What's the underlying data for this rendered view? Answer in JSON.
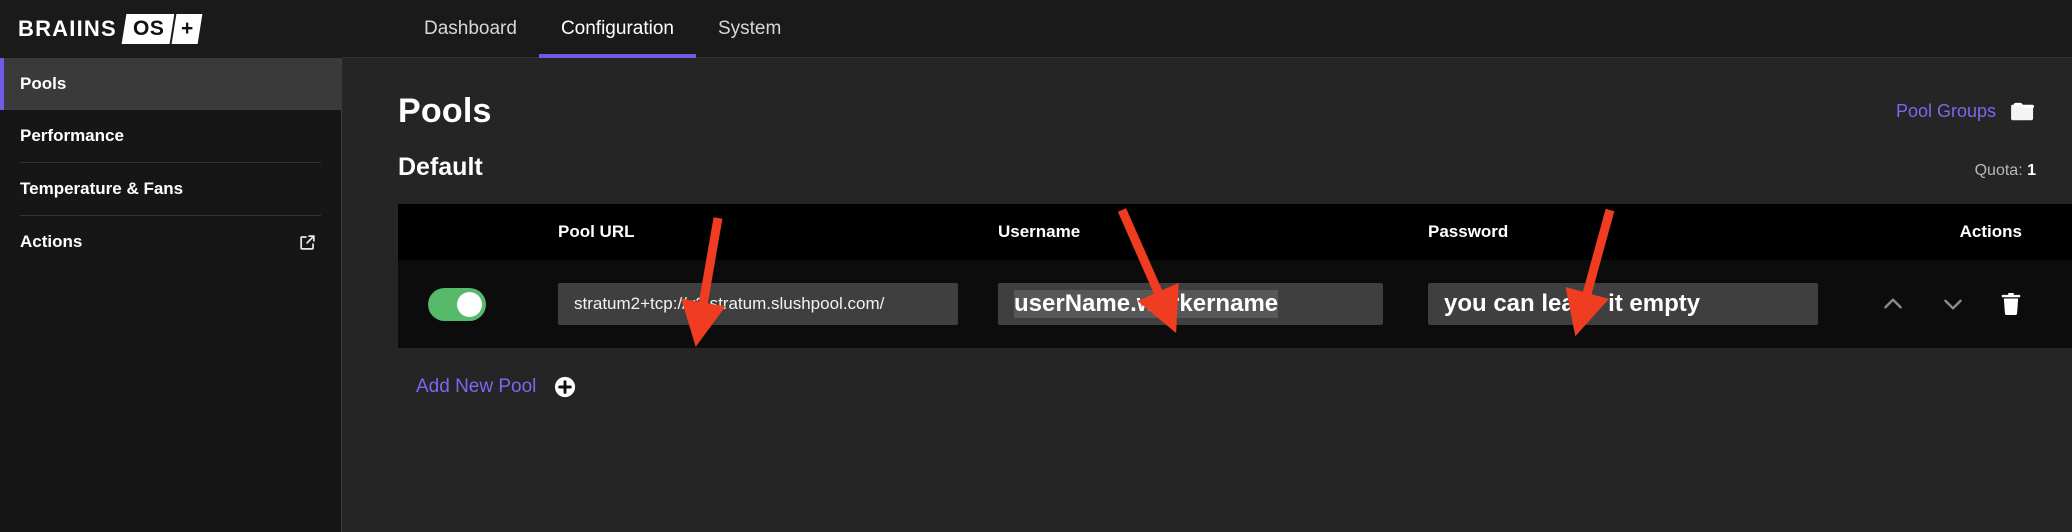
{
  "brand": {
    "name": "BRAIINS",
    "os": "OS",
    "plus": "+"
  },
  "nav": {
    "tabs": [
      {
        "label": "Dashboard",
        "active": false
      },
      {
        "label": "Configuration",
        "active": true
      },
      {
        "label": "System",
        "active": false
      }
    ],
    "accent_color": "#6c5ce7"
  },
  "sidebar": {
    "items": [
      {
        "label": "Pools",
        "active": true,
        "icon": ""
      },
      {
        "label": "Performance",
        "active": false,
        "icon": ""
      },
      {
        "label": "Temperature & Fans",
        "active": false,
        "icon": ""
      },
      {
        "label": "Actions",
        "active": false,
        "icon": "external-link-icon"
      }
    ]
  },
  "page": {
    "title": "Pools",
    "pool_groups_label": "Pool Groups",
    "pool_groups_icon": "folders-icon",
    "section_title": "Default",
    "quota_label": "Quota:",
    "quota_value": "1"
  },
  "table": {
    "headers": {
      "pool_url": "Pool URL",
      "username": "Username",
      "password": "Password",
      "actions": "Actions"
    },
    "rows": [
      {
        "enabled": true,
        "pool_url": "stratum2+tcp://v2.stratum.slushpool.com/",
        "username": "userName.workername",
        "password": "you can leave it empty",
        "action_icons": [
          "chevron-up-icon",
          "chevron-down-icon",
          "trash-icon"
        ]
      }
    ]
  },
  "footer": {
    "add_pool_label": "Add New Pool",
    "add_pool_icon": "plus-circle-icon"
  },
  "annotations": {
    "arrow_color": "#f03c21",
    "count": 3
  }
}
